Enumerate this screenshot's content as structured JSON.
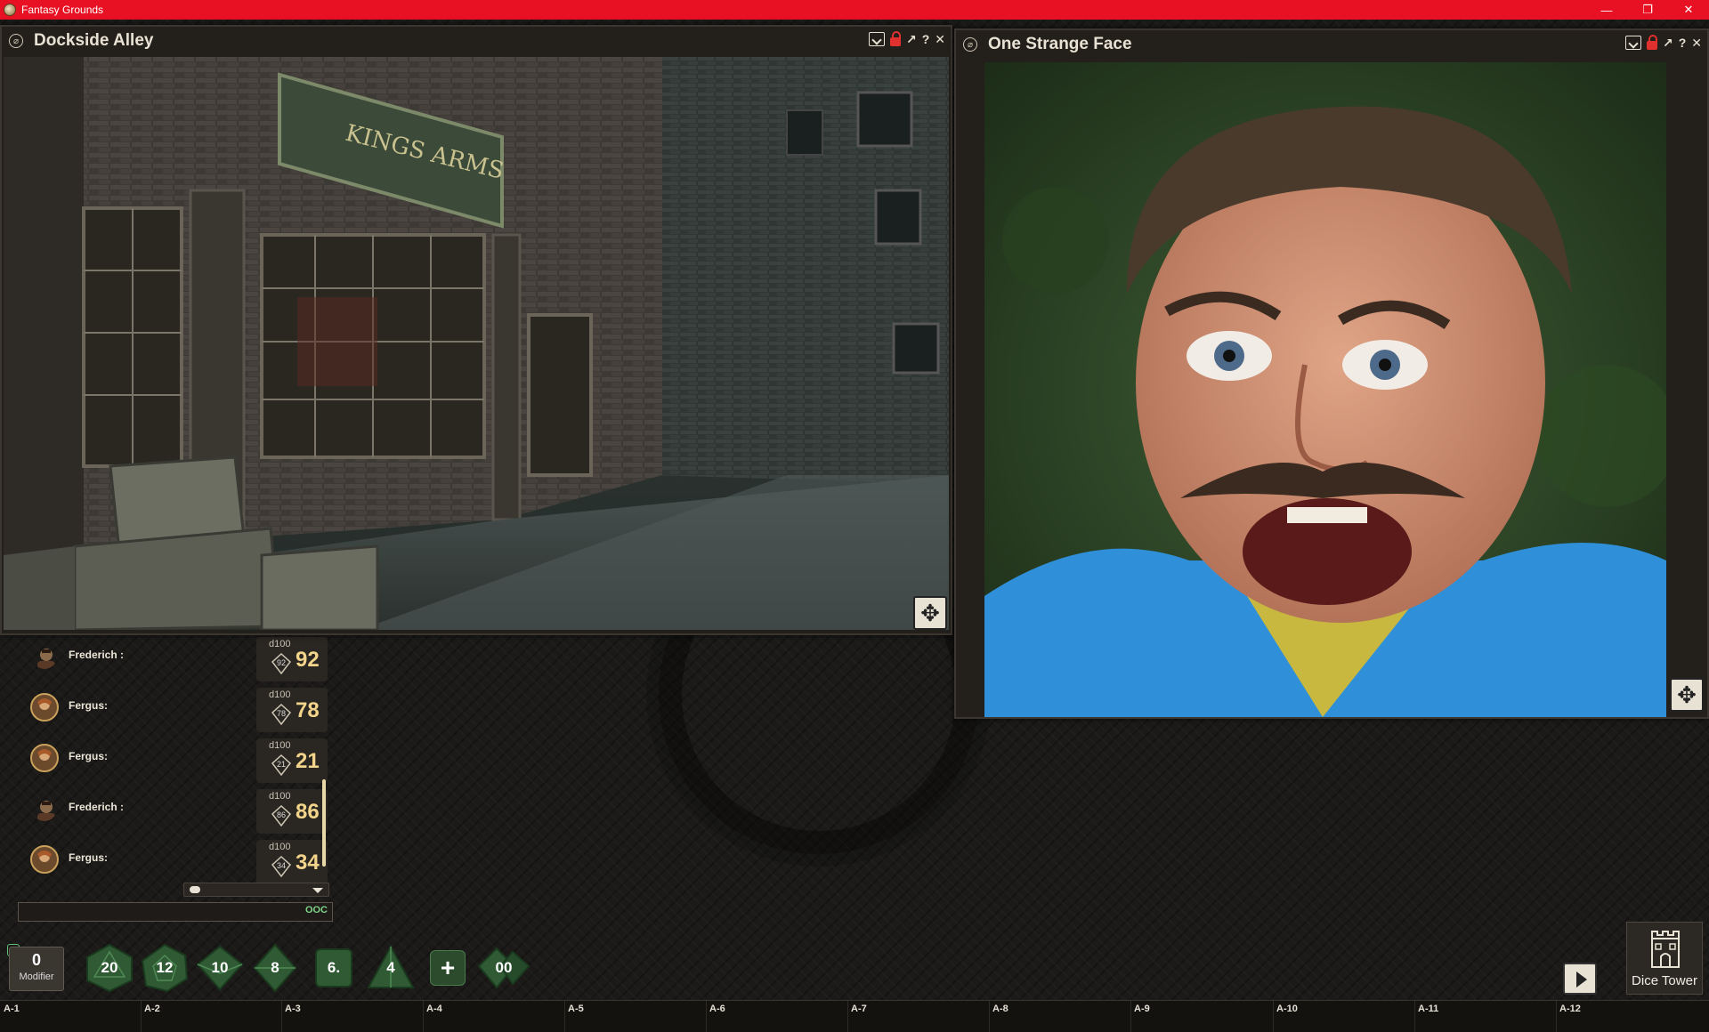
{
  "app": {
    "title": "Fantasy Grounds",
    "controls": {
      "minimize": "—",
      "restore": "❐",
      "close": "✕"
    }
  },
  "windows": {
    "alley": {
      "title": "Dockside Alley",
      "help": "?",
      "close": "✕",
      "expand": "↗"
    },
    "face": {
      "title": "One Strange Face",
      "help": "?",
      "close": "✕",
      "expand": "↗"
    }
  },
  "chat": {
    "entries": [
      {
        "name": "Frederich :",
        "die": "d100",
        "mini": "92",
        "result": "92",
        "avatar": "frederich"
      },
      {
        "name": "Fergus:",
        "die": "d100",
        "mini": "78",
        "result": "78",
        "avatar": "fergus"
      },
      {
        "name": "Fergus:",
        "die": "d100",
        "mini": "21",
        "result": "21",
        "avatar": "fergus"
      },
      {
        "name": "Frederich :",
        "die": "d100",
        "mini": "86",
        "result": "86",
        "avatar": "frederich"
      },
      {
        "name": "Fergus:",
        "die": "d100",
        "mini": "34",
        "result": "34",
        "avatar": "fergus"
      }
    ],
    "mode_label": "OOC",
    "input_value": ""
  },
  "dice_bar": {
    "modifier_value": "0",
    "modifier_label": "Modifier",
    "dice": [
      "20",
      "12",
      "10",
      "8",
      "6.",
      "4",
      "00"
    ],
    "plus_label": "+"
  },
  "dice_tower": {
    "label": "Dice Tower"
  },
  "hotkeys": [
    "A-1",
    "A-2",
    "A-3",
    "A-4",
    "A-5",
    "A-6",
    "A-7",
    "A-8",
    "A-9",
    "A-10",
    "A-11",
    "A-12"
  ],
  "colors": {
    "os_bar": "#e81123",
    "accent_gold": "#f2d48a",
    "ooc_green": "#7fd48a",
    "dice_green": "#2c4a2c"
  }
}
